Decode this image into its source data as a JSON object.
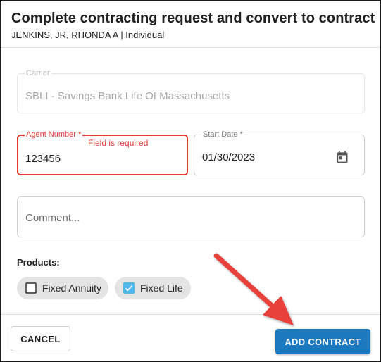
{
  "dialog": {
    "title": "Complete contracting request and convert to contract",
    "subtitle": "JENKINS, JR, RHONDA A | Individual"
  },
  "form": {
    "carrier": {
      "label": "Carrier",
      "value": "SBLI - Savings Bank Life Of Massachusetts",
      "disabled": true
    },
    "agent_number": {
      "label": "Agent Number *",
      "value": "123456",
      "error": "Field is required"
    },
    "start_date": {
      "label": "Start Date *",
      "value": "01/30/2023",
      "icon": "calendar-icon"
    },
    "comment": {
      "placeholder": "Comment..."
    }
  },
  "products": {
    "label": "Products:",
    "items": [
      {
        "label": "Fixed Annuity",
        "checked": false
      },
      {
        "label": "Fixed Life",
        "checked": true
      }
    ]
  },
  "actions": {
    "cancel_label": "CANCEL",
    "add_label": "ADD CONTRACT"
  },
  "colors": {
    "error": "#e53935",
    "primary_button": "#1c78bf",
    "checkbox_checked": "#4fb8e8",
    "annotation_arrow": "#e8413a"
  }
}
